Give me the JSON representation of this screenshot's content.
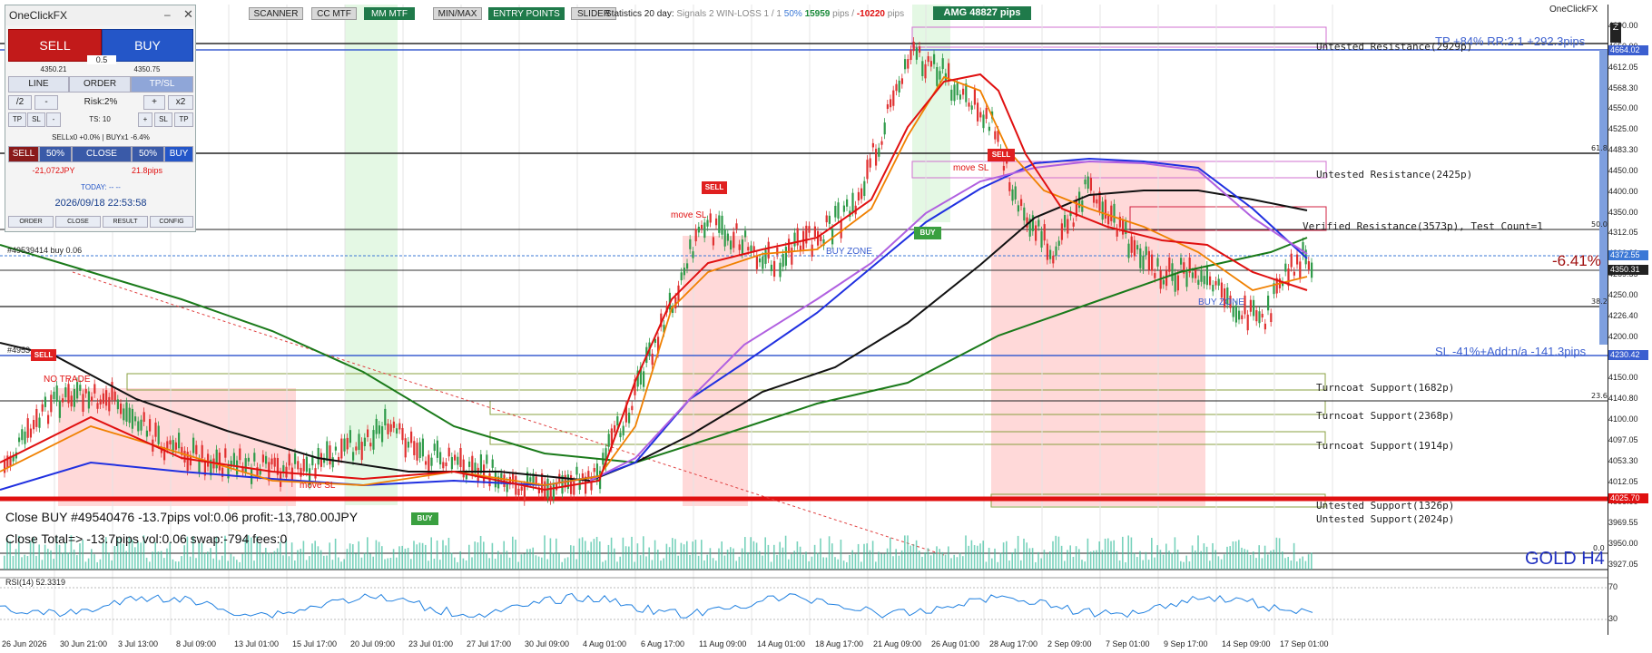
{
  "toolbar": {
    "buttons": [
      "SCANNER",
      "CC MTF",
      "MM MTF",
      "MIN/MAX",
      "ENTRY POINTS",
      "SLIDER"
    ],
    "stats_prefix": "Statistics 20 day:",
    "signals": "Signals 2",
    "winloss": "WIN-LOSS 1 / 1",
    "pct": "50%",
    "pips_pos": "15959",
    "pips_label": "pips /",
    "pips_neg": "-10220",
    "pips_label2": "pips",
    "amg": "AMG  48827 pips",
    "brand": "OneClickFX"
  },
  "panel": {
    "title": "OneClickFX",
    "sell": "SELL",
    "buy": "BUY",
    "spread": "0.5",
    "bid": "4350.21",
    "ask": "4350.75",
    "tabs": [
      "LINE",
      "ORDER",
      "TP/SL"
    ],
    "half": "/2",
    "minus": "-",
    "risk": "Risk:2%",
    "plus": "+",
    "x2": "x2",
    "tp": "TP",
    "sl": "SL",
    "ts": "TS: 10",
    "positions": "SELLx0 +0.0%  |  BUYx1 -6.4%",
    "row_sell": "SELL",
    "row_50a": "50%",
    "row_close": "CLOSE",
    "row_50b": "50%",
    "row_buy": "BUY",
    "loss_jpy": "-21,072JPY",
    "loss_pips": "21.8pips",
    "today": "TODAY: -- --",
    "datetime": "2026/09/18   22:53:58",
    "footer": [
      "ORDER",
      "CLOSE",
      "RESULT",
      "CONFIG"
    ]
  },
  "price_scale": {
    "labels": [
      "4690.00",
      "4650.00",
      "4612.05",
      "4568.30",
      "4550.00",
      "4525.00",
      "4483.30",
      "4450.00",
      "4400.00",
      "4350.00",
      "4312.05",
      "4300.00",
      "4269.55",
      "4250.00",
      "4226.40",
      "4200.00",
      "4183.30",
      "4150.00",
      "4140.80",
      "4100.00",
      "4097.05",
      "4053.30",
      "4012.05",
      "4000.00",
      "3969.55",
      "3950.00",
      "3927.05"
    ],
    "boxes": [
      {
        "text": "4664.02",
        "color": "#3b5fd0"
      },
      {
        "text": "4372.55",
        "color": "#3b78d6"
      },
      {
        "text": "4350.31",
        "color": "#222222"
      },
      {
        "text": "4230.42",
        "color": "#3b5fd0"
      },
      {
        "text": "4025.70",
        "color": "#e01010"
      }
    ],
    "fib": [
      "61.8",
      "50.0",
      "38.2",
      "23.6",
      "0.0"
    ]
  },
  "time_axis": [
    "26 Jun 2026",
    "30 Jun 21:00",
    "3 Jul 13:00",
    "8 Jul 09:00",
    "13 Jul 01:00",
    "15 Jul 17:00",
    "20 Jul 09:00",
    "23 Jul 01:00",
    "27 Jul 17:00",
    "30 Jul 09:00",
    "4 Aug 01:00",
    "6 Aug 17:00",
    "11 Aug 09:00",
    "14 Aug 01:00",
    "18 Aug 17:00",
    "21 Aug 09:00",
    "26 Aug 01:00",
    "28 Aug 17:00",
    "2 Sep 09:00",
    "7 Sep 01:00",
    "9 Sep 17:00",
    "14 Sep 09:00",
    "17 Sep 01:00"
  ],
  "zones": {
    "tp": "TP +84% RR:2.1 +292.3pips",
    "untested_res1": "Untested Resistance(2929p)",
    "untested_res2": "Untested Resistance(2425p)",
    "verified_res": "Verified Resistance(3573p), Test Count=1",
    "sl": "SL -41%+Add:n/a -141.3pips",
    "turncoat1": "Turncoat Support(1682p)",
    "turncoat2": "Turncoat Support(2368p)",
    "turncoat3": "Turncoat Support(1914p)",
    "untested_sup1": "Untested Support(1326p)",
    "untested_sup2": "Untested Support(2024p)"
  },
  "chart_labels": {
    "pct": "-6.41%",
    "symbol": "GOLD H4",
    "order_line": "#49539414 buy 0.06",
    "order_line2": "#4953",
    "close_info": "Close BUY #49540476 -13.7pips vol:0.06 profit:-13,780.00JPY",
    "close_total": "Close Total=> -13.7pips vol:0.06 swap:-794 fees:0",
    "no_trade": "NO TRADE",
    "buy_zone": "BUY ZONE",
    "buy_zone2": "BUY ZONE",
    "move_sl1": "move SL",
    "move_sl2": "move SL",
    "move_sl3": "move SL",
    "sell_tag": "SELL",
    "buy_tag": "BUY",
    "rsi": "RSI(14) 52.3319",
    "rsi_levels": [
      "70",
      "30"
    ]
  },
  "colors": {
    "bull": "#2f9b4a",
    "bear": "#e03030",
    "sell_button": "#c21a1a",
    "buy_button": "#2456c8",
    "red_zone": "#ffcccc",
    "green_zone": "#d6f5d6"
  }
}
